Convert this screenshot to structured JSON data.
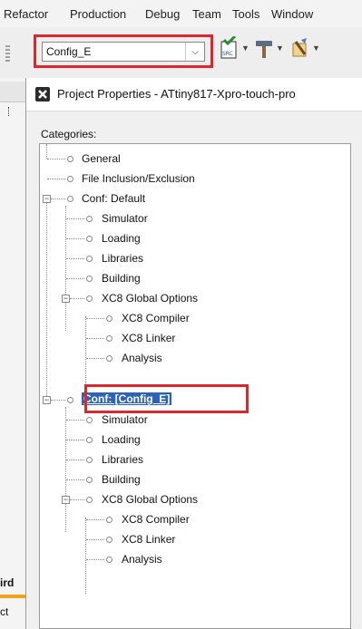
{
  "menubar": {
    "items": [
      "Refactor",
      "Production",
      "Debug",
      "Team",
      "Tools",
      "Window"
    ]
  },
  "toolbar": {
    "configuration_value": "Config_E",
    "icons": [
      "source-icon",
      "build-hammer-icon",
      "clean-build-icon"
    ]
  },
  "left_fragments": {
    "bold_text": "ird",
    "text": "ct"
  },
  "dialog": {
    "title": "Project Properties - ATtiny817-Xpro-touch-pro",
    "categories_label": "Categories:"
  },
  "tree": {
    "general": "General",
    "file_inclusion": "File Inclusion/Exclusion",
    "conf_default": {
      "label": "Conf: Default",
      "simulator": "Simulator",
      "loading": "Loading",
      "libraries": "Libraries",
      "building": "Building",
      "xc8_global": {
        "label": "XC8 Global Options",
        "compiler": "XC8 Compiler",
        "linker": "XC8 Linker",
        "analysis": "Analysis"
      }
    },
    "conf_config_e": {
      "label": "Conf: [Config_E]",
      "simulator": "Simulator",
      "loading": "Loading",
      "libraries": "Libraries",
      "building": "Building",
      "xc8_global": {
        "label": "XC8 Global Options",
        "compiler": "XC8 Compiler",
        "linker": "XC8 Linker",
        "analysis": "Analysis"
      }
    }
  },
  "colors": {
    "highlight_box": "#e0262c",
    "selection": "#2a63b8"
  }
}
